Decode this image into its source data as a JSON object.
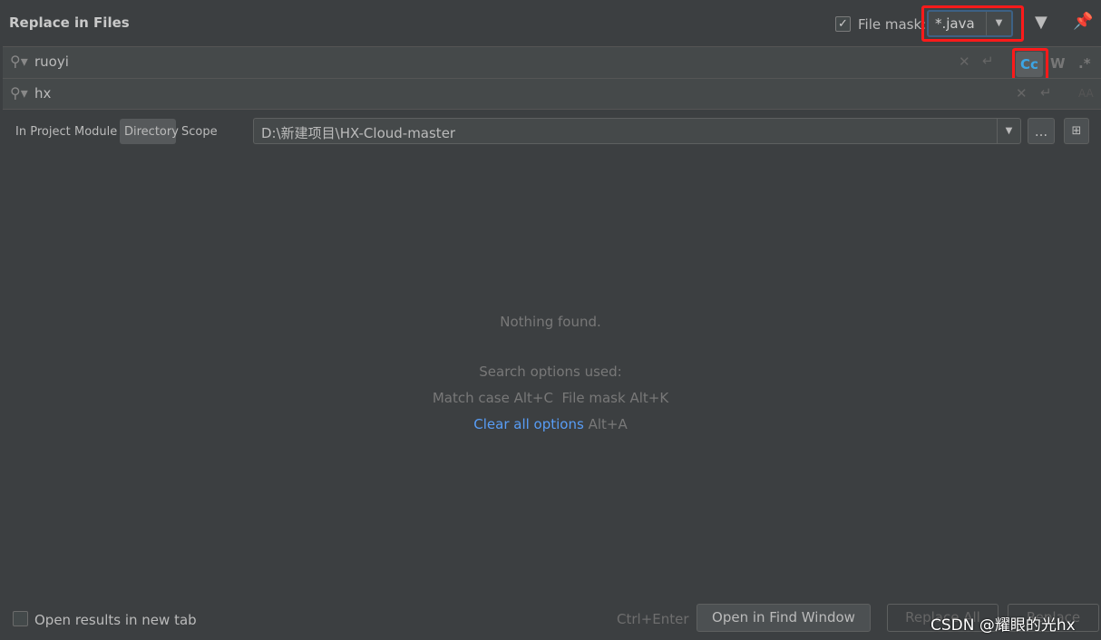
{
  "title": "Replace in Files",
  "file_mask": {
    "checked": true,
    "label": "File mask:",
    "value": "*.java"
  },
  "search": {
    "value": "ruoyi",
    "match_case_label": "Cc",
    "words_label": "W",
    "regex_label": ".*"
  },
  "replace": {
    "value": "hx",
    "preserve_case_label": "AA"
  },
  "scope": {
    "tabs": [
      "In Project",
      "Module",
      "Directory",
      "Scope"
    ],
    "active": "Directory",
    "path": "D:\\新建项目\\HX-Cloud-master",
    "browse_label": "..."
  },
  "results": {
    "message": "Nothing found.",
    "options_heading": "Search options used:",
    "options_used": "Match case Alt+C  File mask Alt+K",
    "clear_link": "Clear all options",
    "clear_shortcut": "Alt+A"
  },
  "footer": {
    "new_tab_label": "Open results in new tab",
    "shortcut": "Ctrl+Enter",
    "open_find": "Open in Find Window",
    "replace_all": "Replace All",
    "replace": "Replace"
  },
  "watermark": "CSDN @耀眼的光hx",
  "colors": {
    "accent": "#589df6",
    "highlight": "#ff1a1a",
    "bg": "#3c3f41"
  }
}
